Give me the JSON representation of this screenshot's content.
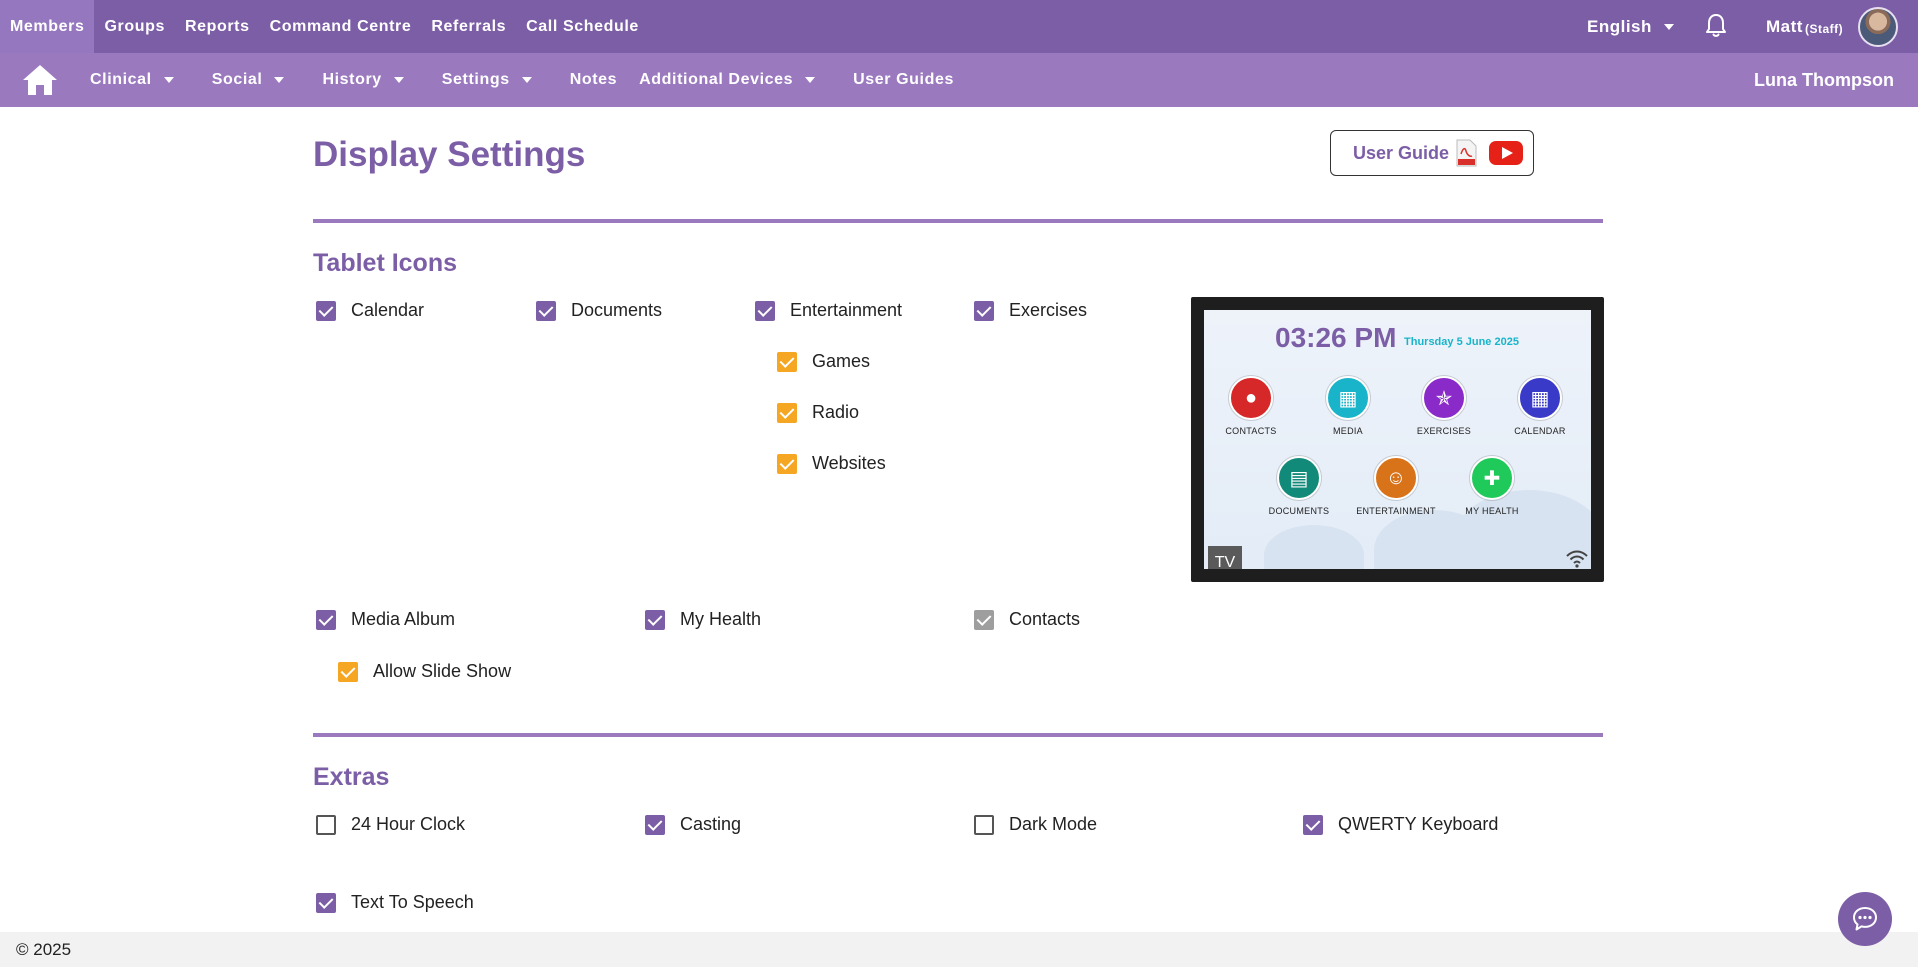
{
  "topnav": {
    "items": [
      "Members",
      "Groups",
      "Reports",
      "Command Centre",
      "Referrals",
      "Call Schedule"
    ],
    "language": "English",
    "user_name": "Matt",
    "user_role": "(Staff)"
  },
  "subnav": {
    "items": [
      "Clinical",
      "Social",
      "History",
      "Settings",
      "Notes",
      "Additional Devices",
      "User Guides"
    ],
    "member_name": "Luna Thompson"
  },
  "page": {
    "title": "Display Settings",
    "user_guide_label": "User Guide"
  },
  "tablet_icons": {
    "title": "Tablet Icons",
    "calendar": {
      "label": "Calendar",
      "checked": true
    },
    "documents": {
      "label": "Documents",
      "checked": true
    },
    "entertainment": {
      "label": "Entertainment",
      "checked": true
    },
    "exercises": {
      "label": "Exercises",
      "checked": true
    },
    "games": {
      "label": "Games",
      "checked": true
    },
    "radio": {
      "label": "Radio",
      "checked": true
    },
    "websites": {
      "label": "Websites",
      "checked": true
    },
    "media_album": {
      "label": "Media Album",
      "checked": true
    },
    "my_health": {
      "label": "My Health",
      "checked": true
    },
    "contacts": {
      "label": "Contacts",
      "checked": true,
      "disabled": true
    },
    "allow_slide_show": {
      "label": "Allow Slide Show",
      "checked": true
    }
  },
  "preview": {
    "time": "03:26 PM",
    "date": "Thursday  5 June 2025",
    "tv_label": "TV",
    "apps": [
      "CONTACTS",
      "MEDIA",
      "EXERCISES",
      "CALENDAR",
      "DOCUMENTS",
      "ENTERTAINMENT",
      "MY HEALTH"
    ]
  },
  "extras": {
    "title": "Extras",
    "clock_24": {
      "label": "24 Hour Clock",
      "checked": false
    },
    "casting": {
      "label": "Casting",
      "checked": true
    },
    "dark_mode": {
      "label": "Dark Mode",
      "checked": false
    },
    "qwerty": {
      "label": "QWERTY Keyboard",
      "checked": true
    },
    "tts": {
      "label": "Text To Speech",
      "checked": true
    }
  },
  "footer": {
    "copyright": "© 2025"
  },
  "colors": {
    "primary": "#7c5ea6",
    "secondary": "#9b79bf",
    "accent": "#f5a623",
    "clock_date": "#19b4c9"
  }
}
